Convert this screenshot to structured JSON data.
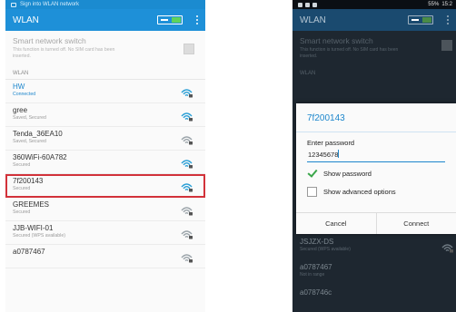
{
  "left": {
    "status_text": "Sign into WLAN network",
    "title": "WLAN",
    "smart_switch": {
      "title": "Smart network switch",
      "subtitle": "This function is turned off. No SIM card has been inserted."
    },
    "section": "WLAN",
    "networks": [
      {
        "name": "HW",
        "status": "Connected",
        "highlight": true
      },
      {
        "name": "gree",
        "status": "Saved, Secured",
        "highlight": false
      },
      {
        "name": "Tenda_36EA10",
        "status": "Saved, Secured",
        "highlight": false
      },
      {
        "name": "360WiFi-60A782",
        "status": "Secured",
        "highlight": false
      },
      {
        "name": "7f200143",
        "status": "Secured",
        "highlight": false
      },
      {
        "name": "GREEMES",
        "status": "Secured",
        "highlight": false
      },
      {
        "name": "JJB-WIFI-01",
        "status": "Secured (WPS available)",
        "highlight": false
      },
      {
        "name": "a0787467",
        "status": "",
        "highlight": false
      }
    ]
  },
  "right": {
    "status_time": "15:2",
    "status_battery": "55%",
    "title": "WLAN",
    "smart_switch": {
      "title": "Smart network switch",
      "subtitle": "This function is turned off. No SIM card has been inserted."
    },
    "section": "WLAN",
    "dialog": {
      "title": "7f200143",
      "password_label": "Enter password",
      "password_value": "12345678",
      "show_password": "Show password",
      "show_advanced": "Show advanced options",
      "cancel": "Cancel",
      "connect": "Connect"
    },
    "below": [
      {
        "name": "JSJZX-DS",
        "status": "Secured (WPS available)"
      },
      {
        "name": "a0787467",
        "status": "Not in range"
      },
      {
        "name": "a078746c",
        "status": ""
      }
    ]
  }
}
